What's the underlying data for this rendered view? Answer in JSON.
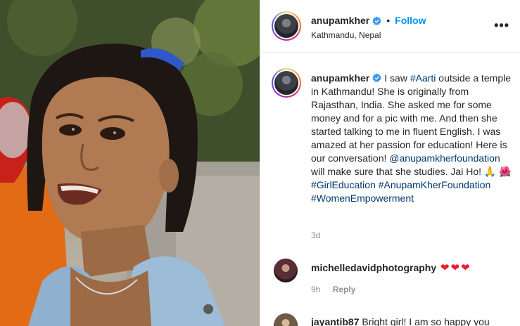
{
  "post": {
    "username": "anupamkher",
    "separator": "•",
    "follow_label": "Follow",
    "location": "Kathmandu, Nepal",
    "more_label": "•••",
    "caption": {
      "username": "anupamkher",
      "text_1": "I saw ",
      "hashtag_aarti": "#Aarti",
      "text_2": " outside a temple in Kathmandu! She is originally from Rajasthan, India. She asked me for some money and for a pic with me. And then she started talking to me in fluent English. I was amazed at her passion for education! Here is our conversation! ",
      "mention": "@anupamkherfoundation",
      "text_3": " will make sure that she studies. Jai Ho! 🙏 🌺 ",
      "hashtag_1": "#GirlEducation",
      "hashtag_2": "#AnupamKherFoundation",
      "hashtag_3": "#WomenEmpowerment"
    },
    "time_ago": "3d"
  },
  "comments": [
    {
      "username": "michelledavidphotography",
      "text": "❤❤❤",
      "time_ago": "9h",
      "reply_label": "Reply"
    },
    {
      "username": "jayantib87",
      "text": "Bright girl! I am so happy you"
    }
  ],
  "colors": {
    "link": "#00376b",
    "follow": "#0095f6",
    "verified": "#3897f0",
    "heart": "#ed1c2e"
  }
}
